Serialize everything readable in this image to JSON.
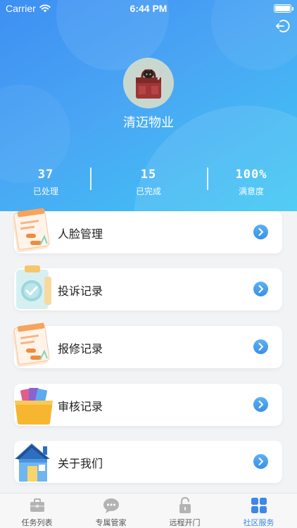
{
  "status_bar": {
    "carrier": "Carrier",
    "time": "6:44 PM"
  },
  "profile": {
    "name": "清迈物业"
  },
  "stats": [
    {
      "value": "37",
      "label": "已处理"
    },
    {
      "value": "15",
      "label": "已完成"
    },
    {
      "value": "100%",
      "label": "满意度"
    }
  ],
  "menu": [
    {
      "label": "人脸管理",
      "icon": "form-document-icon"
    },
    {
      "label": "投诉记录",
      "icon": "clipboard-check-icon"
    },
    {
      "label": "报修记录",
      "icon": "form-document-icon"
    },
    {
      "label": "审核记录",
      "icon": "folder-files-icon"
    },
    {
      "label": "关于我们",
      "icon": "house-icon"
    }
  ],
  "tabs": [
    {
      "label": "任务列表",
      "icon": "briefcase-icon",
      "active": false
    },
    {
      "label": "专属管家",
      "icon": "chat-bubble-icon",
      "active": false
    },
    {
      "label": "远程开门",
      "icon": "unlock-icon",
      "active": false
    },
    {
      "label": "社区服务",
      "icon": "grid-icon",
      "active": true
    }
  ],
  "colors": {
    "header_start": "#3d8ff2",
    "header_end": "#3fc8f3",
    "accent": "#3d87e8",
    "tab_inactive": "#b0b0b0"
  }
}
